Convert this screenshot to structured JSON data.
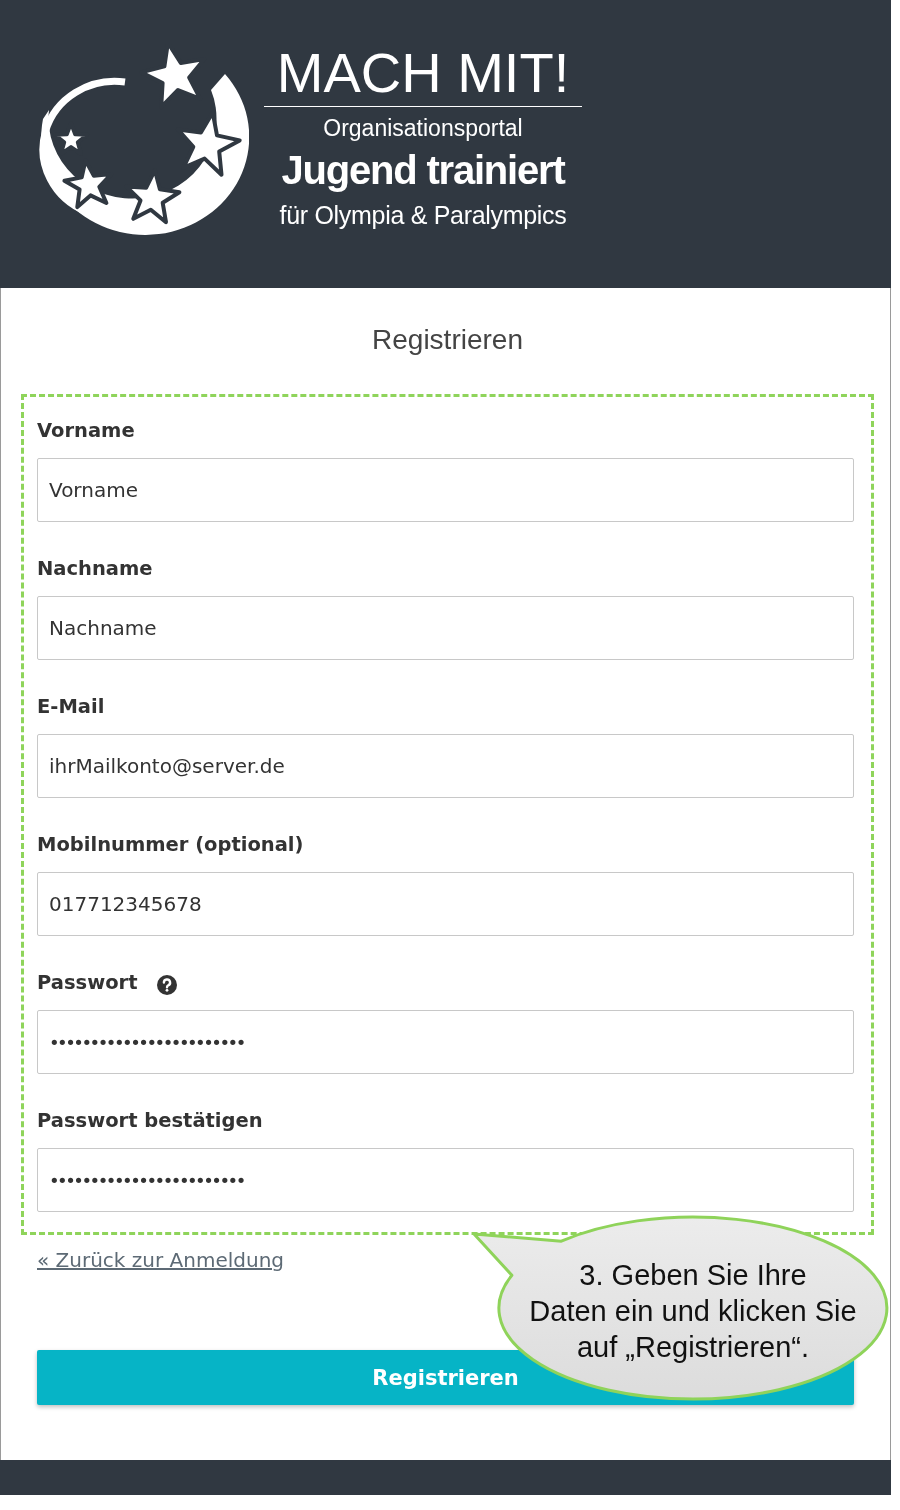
{
  "header": {
    "title": "MACH MIT!",
    "subtitle": "Organisationsportal",
    "brand": "Jugend trainiert",
    "tagline": "für Olympia & Paralympics"
  },
  "form": {
    "title": "Registrieren",
    "fields": [
      {
        "label": "Vorname",
        "value": "Vorname",
        "kind": "text",
        "help": false
      },
      {
        "label": "Nachname",
        "value": "Nachname",
        "kind": "text",
        "help": false
      },
      {
        "label": "E-Mail",
        "value": "ihrMailkonto@server.de",
        "kind": "text",
        "help": false
      },
      {
        "label": "Mobilnummer (optional)",
        "value": "017712345678",
        "kind": "text",
        "help": false
      },
      {
        "label": "Passwort",
        "value": "••••••••••••••••••••••••",
        "kind": "password",
        "help": true
      },
      {
        "label": "Passwort bestätigen",
        "value": "••••••••••••••••••••••••",
        "kind": "password",
        "help": false
      }
    ],
    "back_link": "« Zurück zur Anmeldung",
    "submit_button": "Registrieren"
  },
  "callout": {
    "text": "3. Geben Sie Ihre\nDaten ein und klicken Sie\nauf „Registrieren“."
  }
}
